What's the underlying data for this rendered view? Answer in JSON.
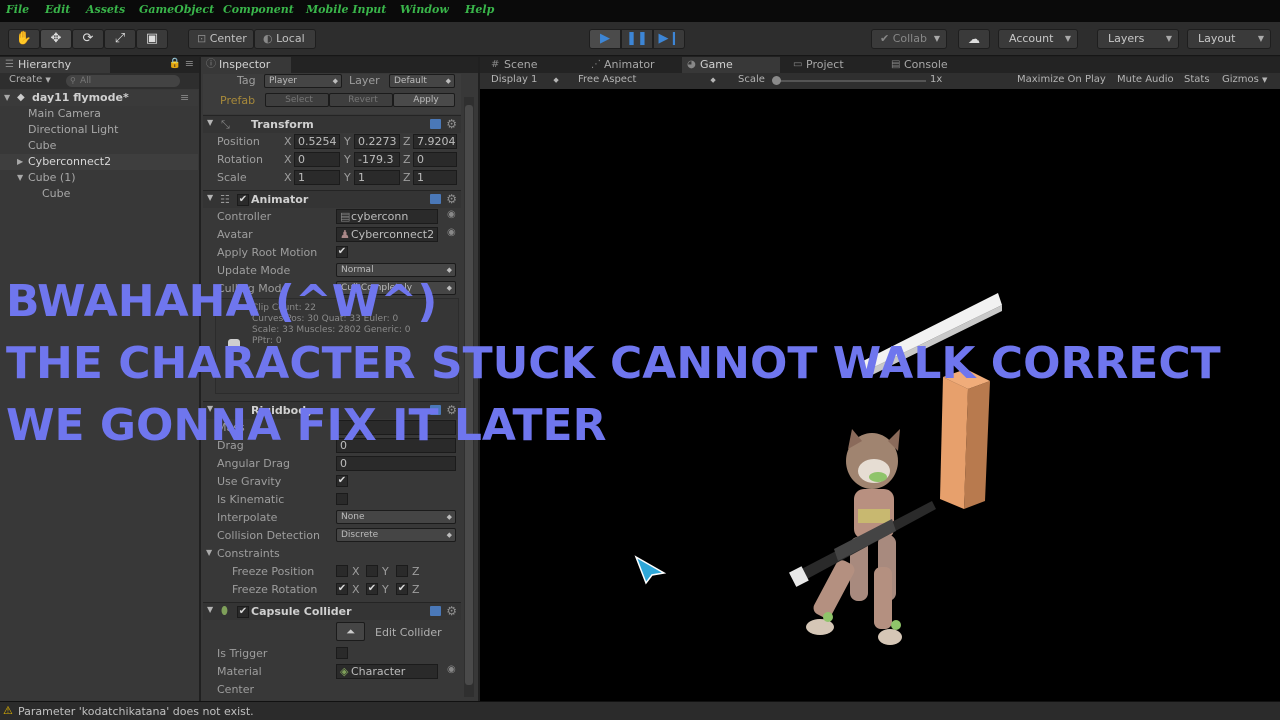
{
  "menu": [
    "File",
    "Edit",
    "Assets",
    "GameObject",
    "Component",
    "Mobile Input",
    "Window",
    "Help"
  ],
  "toolbar": {
    "center_label": "Center",
    "local_label": "Local",
    "collab_label": "Collab",
    "account_label": "Account",
    "layers_label": "Layers",
    "layout_label": "Layout"
  },
  "hierarchy": {
    "tab": "Hierarchy",
    "create_label": "Create",
    "search_placeholder": "All",
    "scene": "day11 flymode*",
    "items": [
      "Main Camera",
      "Directional Light",
      "Cube",
      "Cyberconnect2",
      "Cube (1)",
      "Cube"
    ]
  },
  "inspector": {
    "tab": "Inspector",
    "tag_label": "Tag",
    "tag_value": "Player",
    "layer_label": "Layer",
    "layer_value": "Default",
    "prefab_label": "Prefab",
    "select_label": "Select",
    "revert_label": "Revert",
    "apply_label": "Apply",
    "transform": {
      "title": "Transform",
      "position_label": "Position",
      "rotation_label": "Rotation",
      "scale_label": "Scale",
      "x": "X",
      "y": "Y",
      "z": "Z",
      "position": [
        "0.5254",
        "0.2273",
        "7.9204"
      ],
      "rotation": [
        "0",
        "-179.3",
        "0"
      ],
      "scale": [
        "1",
        "1",
        "1"
      ]
    },
    "animator": {
      "title": "Animator",
      "controller_label": "Controller",
      "controller_value": "cyberconn",
      "avatar_label": "Avatar",
      "avatar_value": "Cyberconnect2",
      "root_motion_label": "Apply Root Motion",
      "update_mode_label": "Update Mode",
      "update_mode_value": "Normal",
      "culling_label": "Culling Mode",
      "culling_value": "Cull Completely",
      "info1": "Clip Count: 22",
      "info2": "Curves Pos: 30 Quat: 33 Euler: 0",
      "info3": "Scale: 33 Muscles: 2802 Generic: 0",
      "info4": "PPtr: 0"
    },
    "rigidbody": {
      "title": "Rigidbody",
      "mass_label": "Mass",
      "drag_label": "Drag",
      "drag_value": "0",
      "angular_drag_label": "Angular Drag",
      "angular_drag_value": "0",
      "use_gravity_label": "Use Gravity",
      "kinematic_label": "Is Kinematic",
      "interpolate_label": "Interpolate",
      "interpolate_value": "None",
      "collision_label": "Collision Detection",
      "collision_value": "Discrete",
      "constraints_label": "Constraints",
      "freeze_pos_label": "Freeze Position",
      "freeze_rot_label": "Freeze Rotation"
    },
    "capsule": {
      "title": "Capsule Collider",
      "edit_label": "Edit Collider",
      "trigger_label": "Is Trigger",
      "material_label": "Material",
      "material_value": "Character",
      "center_label": "Center"
    }
  },
  "view_tabs": {
    "scene": "Scene",
    "animator": "Animator",
    "game": "Game",
    "project": "Project",
    "console": "Console"
  },
  "game_bar": {
    "display": "Display 1",
    "aspect": "Free Aspect",
    "scale_label": "Scale",
    "scale_value": "1x",
    "maximize": "Maximize On Play",
    "mute": "Mute Audio",
    "stats": "Stats",
    "gizmos": "Gizmos"
  },
  "overlay": {
    "line1": "BWAHAHA  (^W^)",
    "line2": "THE CHARACTER STUCK CANNOT WALK CORRECT",
    "line3": "WE GONNA FIX IT LATER"
  },
  "status": {
    "message": "Parameter 'kodatchikatana' does not exist."
  },
  "colors": {
    "overlay_text": "#6f76ee",
    "menu_text": "#39b54a",
    "play_blue": "#3d86d6",
    "warning": "#e6b800"
  }
}
